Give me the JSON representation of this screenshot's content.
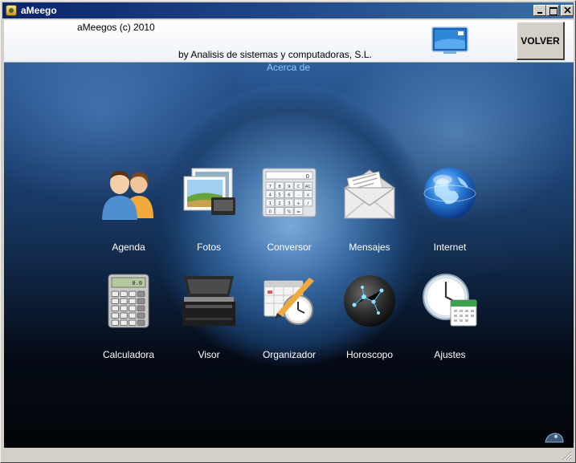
{
  "window": {
    "title": "aMeego"
  },
  "header": {
    "copyright": "aMeegos (c) 2010",
    "company": "by Analisis de sistemas y computadoras, S.L.",
    "about_link": "Acerca de",
    "back_button": "VOLVER"
  },
  "apps": [
    {
      "label": "Agenda",
      "icon": "contacts-icon"
    },
    {
      "label": "Fotos",
      "icon": "photos-icon"
    },
    {
      "label": "Conversor",
      "icon": "converter-calculator-icon"
    },
    {
      "label": "Mensajes",
      "icon": "envelope-icon"
    },
    {
      "label": "Internet",
      "icon": "globe-icon"
    },
    {
      "label": "Calculadora",
      "icon": "calculator-icon"
    },
    {
      "label": "Visor",
      "icon": "scanner-icon"
    },
    {
      "label": "Organizador",
      "icon": "organizer-icon"
    },
    {
      "label": "Horoscopo",
      "icon": "constellation-icon"
    },
    {
      "label": "Ajustes",
      "icon": "clock-calendar-icon"
    }
  ],
  "converter_keys": [
    "7",
    "8",
    "9",
    "C",
    "AC",
    "4",
    "5",
    "6",
    "-",
    "x",
    "1",
    "2",
    "3",
    "+",
    "/",
    "0",
    ".",
    "%",
    "="
  ],
  "calculator_display": "0.0"
}
